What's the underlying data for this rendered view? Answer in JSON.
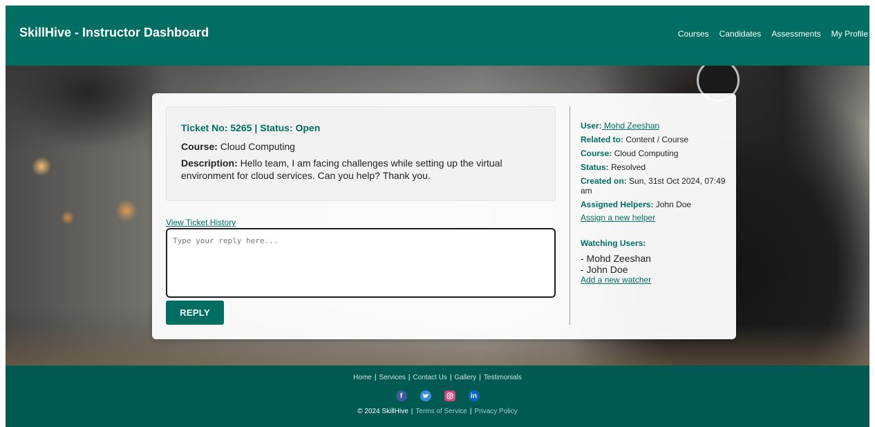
{
  "header": {
    "brand": "SkillHive - Instructor Dashboard",
    "nav": [
      "Courses",
      "Candidates",
      "Assessments",
      "My Profile"
    ]
  },
  "ticket": {
    "heading": "Ticket No: 5265 | Status: Open",
    "course_label": "Course:",
    "course_value": "Cloud Computing",
    "description_label": "Description:",
    "description_value": "Hello team, I am facing challenges while setting up the virtual environment for cloud services. Can you help? Thank you.",
    "history_link": "View Ticket History",
    "reply_placeholder": "Type your reply here...",
    "reply_button": "REPLY"
  },
  "details": {
    "user_label": "User:",
    "user_value": " Mohd Zeeshan",
    "related_label": "Related to:",
    "related_value": "Content / Course",
    "course_label": "Course:",
    "course_value": "Cloud Computing",
    "status_label": "Status:",
    "status_value": "Resolved",
    "created_label": "Created on:",
    "created_value": "Sun, 31st Oct 2024, 07:49 am",
    "helpers_label": "Assigned Helpers:",
    "helpers_value": "John Doe",
    "assign_link": "Assign a new helper",
    "watching_label": "Watching Users:",
    "watchers": [
      "- Mohd Zeeshan",
      "- John Doe"
    ],
    "add_watcher_link": "Add a new watcher"
  },
  "footer": {
    "links": [
      "Home",
      "Services",
      "Contact Us",
      "Gallery",
      "Testimonials"
    ],
    "social": [
      "facebook-icon",
      "twitter-icon",
      "instagram-icon",
      "linkedin-icon"
    ],
    "copyright": "© 2024 SkillHive",
    "terms": "Terms of Service",
    "privacy": "Privacy Policy"
  },
  "colors": {
    "brand": "#006e63",
    "footer": "#005a52"
  }
}
